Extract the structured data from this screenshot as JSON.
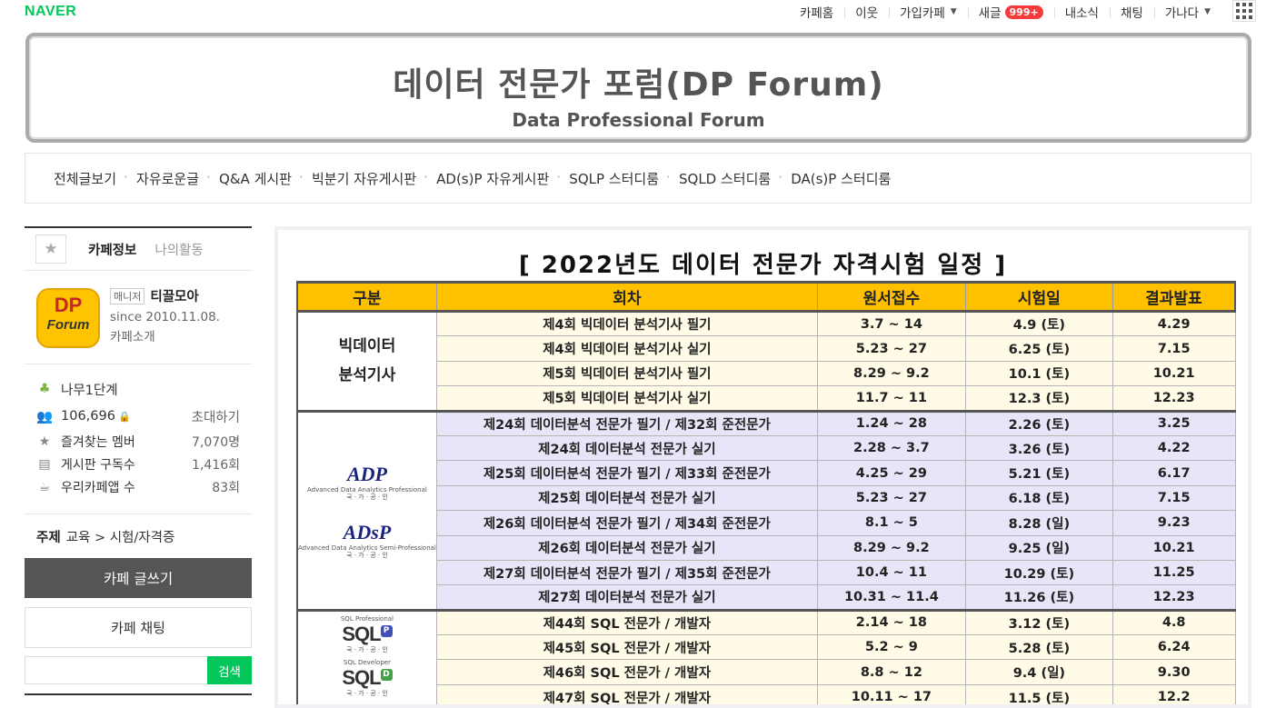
{
  "topbar": {
    "logo": "NAVER",
    "links": [
      "카페홈",
      "이웃",
      "가입카페",
      "새글",
      "내소식",
      "채팅",
      "가나다"
    ],
    "new_badge": "999+"
  },
  "banner": {
    "title": "데이터 전문가 포럼(DP Forum)",
    "subtitle": "Data Professional Forum"
  },
  "menu": [
    "전체글보기",
    "자유로운글",
    "Q&A 게시판",
    "빅분기 자유게시판",
    "AD(s)P 자유게시판",
    "SQLP 스터디룸",
    "SQLD 스터디룸",
    "DA(s)P 스터디룸"
  ],
  "sidebar": {
    "tab_info": "카페정보",
    "tab_activity": "나의활동",
    "manager_tag": "매니저",
    "manager_name": "티끌모아",
    "since": "since 2010.11.08.",
    "intro": "카페소개",
    "logo_dp": "DP",
    "logo_forum": "Forum",
    "level": "나무1단계",
    "members": "106,696",
    "invite": "초대하기",
    "fav_label": "즐겨찾는 멤버",
    "fav_value": "7,070명",
    "sub_label": "게시판 구독수",
    "sub_value": "1,416회",
    "app_label": "우리카페앱 수",
    "app_value": "83회",
    "subject_label": "주제",
    "subject_value": "교육 > 시험/자격증",
    "write": "카페 글쓰기",
    "chat": "카페 채팅",
    "search_btn": "검색"
  },
  "schedule": {
    "title": "[ 2022년도 데이터 전문가 자격시험 일정 ]",
    "headers": [
      "구분",
      "회차",
      "원서접수",
      "시험일",
      "결과발표"
    ],
    "bigdata_label_1": "빅데이터",
    "bigdata_label_2": "분석기사",
    "adp_logo": "ADP",
    "adsp_logo": "ADsP",
    "adp_sub": "Advanced Data Analytics Professional",
    "adsp_sub": "Advanced Data Analytics Semi-Professional",
    "kr_sub": "국 · 가 · 공 · 인",
    "sqlp_logo": "SQL",
    "sqld_logo": "SQL",
    "sqlp_badge": "P",
    "sqld_badge": "D",
    "sqlp_sub": "SQL Professional",
    "sqld_sub": "SQL Developer",
    "rows": [
      {
        "round": "제4회 빅데이터 분석기사 필기",
        "apply": "3.7 ~ 14",
        "exam": "4.9 (토)",
        "result": "4.29"
      },
      {
        "round": "제4회 빅데이터 분석기사 실기",
        "apply": "5.23 ~ 27",
        "exam": "6.25 (토)",
        "result": "7.15"
      },
      {
        "round": "제5회 빅데이터 분석기사 필기",
        "apply": "8.29 ~ 9.2",
        "exam": "10.1 (토)",
        "result": "10.21"
      },
      {
        "round": "제5회 빅데이터 분석기사 실기",
        "apply": "11.7 ~ 11",
        "exam": "12.3 (토)",
        "result": "12.23"
      },
      {
        "round": "제24회 데이터분석 전문가 필기 / 제32회 준전문가",
        "apply": "1.24 ~ 28",
        "exam": "2.26 (토)",
        "result": "3.25"
      },
      {
        "round": "제24회 데이터분석 전문가 실기",
        "apply": "2.28 ~ 3.7",
        "exam": "3.26 (토)",
        "result": "4.22"
      },
      {
        "round": "제25회 데이터분석 전문가 필기 / 제33회 준전문가",
        "apply": "4.25 ~ 29",
        "exam": "5.21 (토)",
        "result": "6.17"
      },
      {
        "round": "제25회 데이터분석 전문가 실기",
        "apply": "5.23 ~ 27",
        "exam": "6.18 (토)",
        "result": "7.15"
      },
      {
        "round": "제26회 데이터분석 전문가 필기 / 제34회 준전문가",
        "apply": "8.1 ~ 5",
        "exam": "8.28 (일)",
        "result": "9.23"
      },
      {
        "round": "제26회 데이터분석 전문가 실기",
        "apply": "8.29 ~ 9.2",
        "exam": "9.25 (일)",
        "result": "10.21"
      },
      {
        "round": "제27회 데이터분석 전문가 필기 / 제35회 준전문가",
        "apply": "10.4 ~ 11",
        "exam": "10.29 (토)",
        "result": "11.25"
      },
      {
        "round": "제27회 데이터분석 전문가 실기",
        "apply": "10.31 ~ 11.4",
        "exam": "11.26 (토)",
        "result": "12.23"
      },
      {
        "round": "제44회 SQL 전문가 / 개발자",
        "apply": "2.14 ~ 18",
        "exam": "3.12 (토)",
        "result": "4.8"
      },
      {
        "round": "제45회 SQL 전문가 / 개발자",
        "apply": "5.2 ~ 9",
        "exam": "5.28 (토)",
        "result": "6.24"
      },
      {
        "round": "제46회 SQL 전문가 / 개발자",
        "apply": "8.8 ~ 12",
        "exam": "9.4 (일)",
        "result": "9.30"
      },
      {
        "round": "제47회 SQL 전문가 / 개발자",
        "apply": "10.11 ~ 17",
        "exam": "11.5 (토)",
        "result": "12.2"
      }
    ]
  }
}
